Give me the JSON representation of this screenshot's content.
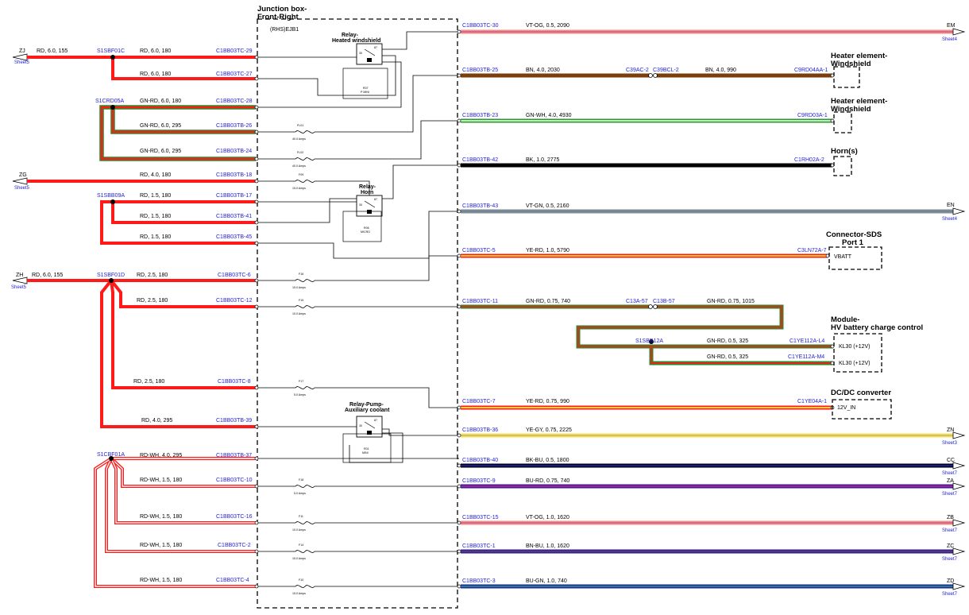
{
  "junction_box": {
    "title_1": "Junction box-",
    "title_2": "Front-Right",
    "code": "(RHS)EJB1"
  },
  "relays": [
    {
      "name_1": "Relay-",
      "name_2": "Heated windshield",
      "code": "R07",
      "type": "P MINI"
    },
    {
      "name_1": "Relay-",
      "name_2": "Horn",
      "code": "R06",
      "type": "MICRO"
    },
    {
      "name_1": "Relay-Pump-",
      "name_2": "Auxiliary coolant",
      "code": "R01",
      "type": "MINI"
    }
  ],
  "relay_pins": [
    "30",
    "87",
    "87a",
    "86",
    "85"
  ],
  "left_feeds": [
    {
      "id": "ZJ",
      "text": "RD, 6.0, 155",
      "sheet": "Sheet5"
    },
    {
      "id": "ZG",
      "text": "",
      "sheet": "Sheet5"
    },
    {
      "id": "ZH",
      "text": "RD, 6.0, 155",
      "sheet": "Sheet5"
    }
  ],
  "splices": [
    "S1SBF01C",
    "S1CRD05A",
    "S1SBB09A",
    "S1SBF01D",
    "S1CBF01A",
    "S1SBB12A"
  ],
  "left_wires": [
    {
      "text": "RD, 6.0, 180",
      "pin": "C1BB03TC-29"
    },
    {
      "text": "RD, 6.0, 180",
      "pin": "C1BB03TC-27"
    },
    {
      "text": "GN-RD, 6.0, 180",
      "pin": "C1BB03TC-28"
    },
    {
      "text": "GN-RD, 6.0, 295",
      "pin": "C1BB03TB-26"
    },
    {
      "text": "GN-RD, 6.0, 295",
      "pin": "C1BB03TB-24"
    },
    {
      "text": "RD, 4.0, 180",
      "pin": "C1BB03TB-18"
    },
    {
      "text": "RD, 1.5, 180",
      "pin": "C1BB03TB-17"
    },
    {
      "text": "RD, 1.5, 180",
      "pin": "C1BB03TB-41"
    },
    {
      "text": "RD, 1.5, 180",
      "pin": "C1BB03TB-45"
    },
    {
      "text": "RD, 2.5, 180",
      "pin": "C1BB03TC-6"
    },
    {
      "text": "RD, 2.5, 180",
      "pin": "C1BB03TC-12"
    },
    {
      "text": "RD, 2.5, 180",
      "pin": "C1BB03TC-8"
    },
    {
      "text": "RD, 4.0, 295",
      "pin": "C1BB03TB-39"
    },
    {
      "text": "RD-WH, 4.0, 295",
      "pin": "C1BB03TB-37"
    },
    {
      "text": "RD-WH, 1.5, 180",
      "pin": "C1BB03TC-10"
    },
    {
      "text": "RD-WH, 1.5, 180",
      "pin": "C1BB03TC-16"
    },
    {
      "text": "RD-WH, 1.5, 180",
      "pin": "C1BB03TC-2"
    },
    {
      "text": "RD-WH, 1.5, 180",
      "pin": "C1BB03TC-4"
    }
  ],
  "fuses": [
    {
      "id": "FL01",
      "rating": "40.0 Amps"
    },
    {
      "id": "FL02",
      "rating": "40.0 Amps"
    },
    {
      "id": "F09",
      "rating": "15.0 Amps"
    },
    {
      "id": "F16",
      "rating": "15.0 Amps"
    },
    {
      "id": "F19",
      "rating": "10.0 Amps"
    },
    {
      "id": "F17",
      "rating": "5.0 Amps"
    },
    {
      "id": "F18",
      "rating": ""
    },
    {
      "id": "F18",
      "rating": "5.0 Amps"
    },
    {
      "id": "F11",
      "rating": "10.0 Amps"
    },
    {
      "id": "F14",
      "rating": "15.0 Amps"
    },
    {
      "id": "F10",
      "rating": "15.0 Amps"
    }
  ],
  "right_wires": [
    {
      "pin": "C1BB03TC-30",
      "text": "VT-OG, 0.5, 2090",
      "end": "EM",
      "sheet": "Sheet4"
    },
    {
      "pin": "C1BB03TB-25",
      "text": "BN, 4.0, 2030",
      "mid1": "C39AC-2",
      "mid2": "C39BCL-2",
      "text2": "BN, 4.0, 990",
      "end_pin": "C9RD04AA-1"
    },
    {
      "pin": "C1BB03TB-23",
      "text": "GN-WH, 4.0, 4930",
      "end_pin": "C9RD03A-1"
    },
    {
      "pin": "C1BB03TB-42",
      "text": "BK, 1.0, 2775",
      "end_pin": "C1RH02A-2"
    },
    {
      "pin": "C1BB03TB-43",
      "text": "VT-GN, 0.5, 2160",
      "end": "EN",
      "sheet": "Sheet4"
    },
    {
      "pin": "C1BB03TC-5",
      "text": "YE-RD, 1.0, 5790",
      "end_pin": "C3LN72A-7"
    },
    {
      "pin": "C1BB03TC-11",
      "text": "GN-RD, 0.75, 740",
      "mid1": "C13A-57",
      "mid2": "C13B-57",
      "text2": "GN-RD, 0.75, 1015"
    },
    {
      "text": "GN-RD, 0.5, 325",
      "end_pin": "C1YE112A-L4"
    },
    {
      "text": "GN-RD, 0.5, 325",
      "end_pin": "C1YE112A-M4"
    },
    {
      "pin": "C1BB03TC-7",
      "text": "YE-RD, 0.75, 990",
      "end_pin": "C1YE04A-1"
    },
    {
      "pin": "C1BB03TB-36",
      "text": "YE-GY, 0.75, 2225",
      "end": "ZN",
      "sheet": "Sheet3"
    },
    {
      "pin": "C1BB03TB-40",
      "text": "BK-BU, 0.5, 1800",
      "end": "CC",
      "sheet": "Sheet7"
    },
    {
      "pin": "C1BB03TC-9",
      "text": "BU-RD, 0.75, 740",
      "end": "ZA",
      "sheet": "Sheet7"
    },
    {
      "pin": "C1BB03TC-15",
      "text": "VT-OG, 1.0, 1620",
      "end": "ZB",
      "sheet": "Sheet7"
    },
    {
      "pin": "C1BB03TC-1",
      "text": "BN-BU, 1.0, 1620",
      "end": "ZC",
      "sheet": "Sheet7"
    },
    {
      "pin": "C1BB03TC-3",
      "text": "BU-GN, 1.0, 740",
      "end": "ZD",
      "sheet": "Sheet7"
    }
  ],
  "components": [
    {
      "title_1": "Heater element-",
      "title_2": "Windshield",
      "pin_label": ""
    },
    {
      "title_1": "Heater element-",
      "title_2": "Windshield",
      "pin_label": ""
    },
    {
      "title_1": "Horn(s)",
      "title_2": "",
      "pin_label": ""
    },
    {
      "title_1": "Connector-SDS",
      "title_2": "Port 1",
      "pin_label": "VBATT"
    },
    {
      "title_1": "Module-",
      "title_2": "HV battery charge control",
      "pin_label": "KL30 (+12V)",
      "pin_label_2": "KL30 (+12V)"
    },
    {
      "title_1": "DC/DC converter",
      "title_2": "",
      "pin_label": "12V_IN"
    }
  ],
  "colors": {
    "red": "#ff1a1a",
    "pin_blue": "#1f1fd6",
    "brown": "#7a3f0d",
    "green": "#2a8a2a"
  }
}
